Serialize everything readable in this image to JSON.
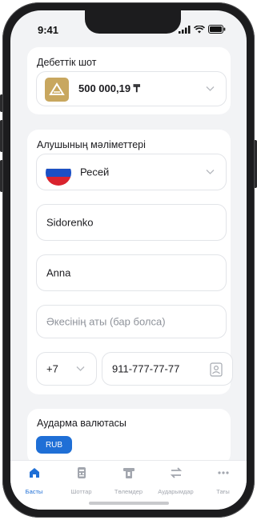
{
  "status_bar": {
    "time": "9:41"
  },
  "debit_account": {
    "title": "Дебеттік шот",
    "amount": "500 000,19 ₸"
  },
  "recipient": {
    "title": "Алушының мәліметтері",
    "country": "Ресей",
    "last_name": "Sidorenko",
    "first_name": "Anna",
    "middle_name_placeholder": "Әкесінің аты (бар болса)",
    "phone_code": "+7",
    "phone_number": "911-777-77-77"
  },
  "currency": {
    "title": "Аудармa валютасы",
    "selected": "RUB"
  },
  "tabs": [
    {
      "label": "Басты",
      "icon": "home-icon",
      "active": true
    },
    {
      "label": "Шоттар",
      "icon": "accounts-icon",
      "active": false
    },
    {
      "label": "Төлемдер",
      "icon": "payments-icon",
      "active": false
    },
    {
      "label": "Аударымдар",
      "icon": "transfers-icon",
      "active": false
    },
    {
      "label": "Тағы",
      "icon": "more-icon",
      "active": false
    }
  ],
  "colors": {
    "accent": "#1f6fd6",
    "card_logo": "#c8a75f"
  }
}
